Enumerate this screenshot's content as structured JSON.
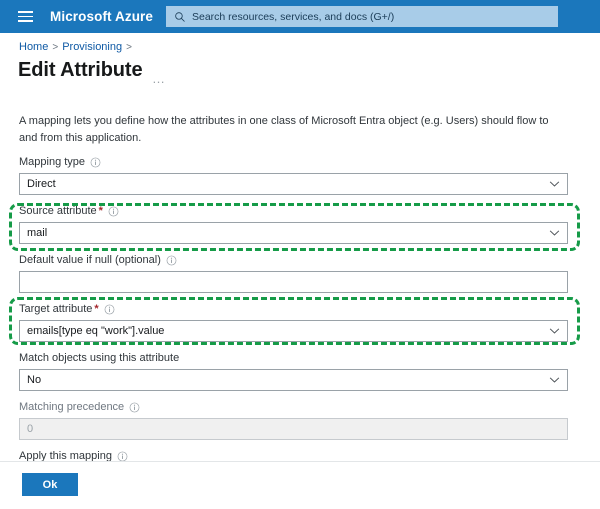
{
  "topbar": {
    "menu_icon": "hamburger-icon",
    "brand": "Microsoft Azure",
    "search": {
      "icon": "search-icon",
      "placeholder": "Search resources, services, and docs (G+/)",
      "value": ""
    }
  },
  "breadcrumb": {
    "items": [
      "Home",
      "Provisioning"
    ],
    "separator": ">"
  },
  "page": {
    "title": "Edit Attribute",
    "more_menu": "…",
    "description": "A mapping lets you define how the attributes in one class of Microsoft Entra object (e.g. Users) should flow to and from this application."
  },
  "form": {
    "fields": [
      {
        "label": "Mapping type",
        "required": false,
        "info": true,
        "value": "Direct",
        "type": "select",
        "disabled": false,
        "placeholder": "",
        "highlighted": false
      },
      {
        "label": "Source attribute",
        "required": true,
        "info": true,
        "value": "mail",
        "type": "select",
        "disabled": false,
        "placeholder": "",
        "highlighted": true
      },
      {
        "label": "Default value if null (optional)",
        "required": false,
        "info": true,
        "value": "",
        "type": "text",
        "disabled": false,
        "placeholder": "",
        "highlighted": false
      },
      {
        "label": "Target attribute",
        "required": true,
        "info": true,
        "value": "emails[type eq \"work\"].value",
        "type": "select",
        "disabled": false,
        "placeholder": "",
        "highlighted": true
      },
      {
        "label": "Match objects using this attribute",
        "required": false,
        "info": false,
        "value": "No",
        "type": "select",
        "disabled": false,
        "placeholder": "",
        "highlighted": false
      },
      {
        "label": "Matching precedence",
        "required": false,
        "info": true,
        "value": "0",
        "type": "text",
        "disabled": true,
        "placeholder": "",
        "highlighted": false
      },
      {
        "label": "Apply this mapping",
        "required": false,
        "info": true,
        "value": "",
        "type": "clipped",
        "disabled": false,
        "placeholder": "",
        "highlighted": false
      }
    ]
  },
  "footer": {
    "ok_label": "Ok"
  },
  "colors": {
    "azure_blue": "#1b77bc",
    "search_field": "#a8cce8",
    "highlight_green": "#169b48",
    "link_blue": "#0f5aa5",
    "required_red": "#a4262c"
  }
}
